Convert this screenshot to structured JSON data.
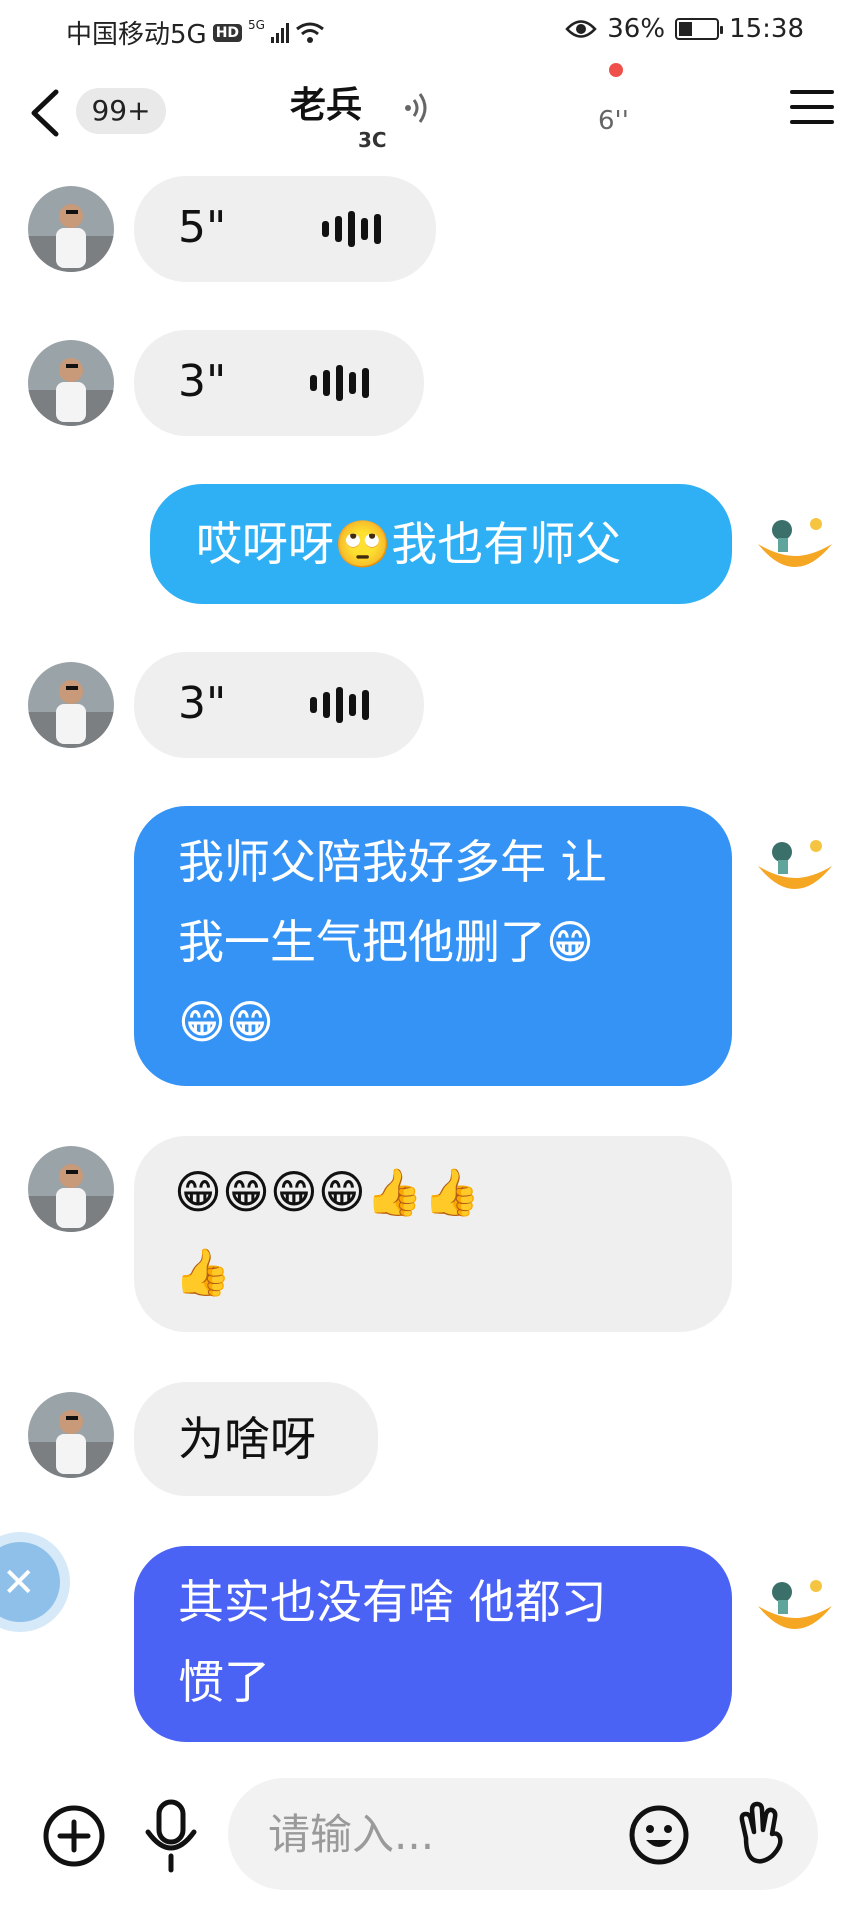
{
  "status_bar": {
    "carrier": "中国移动5G",
    "hd_badge": "HD",
    "net_label": "5G",
    "battery": "36%",
    "battery_level": 0.36,
    "time": "15:38"
  },
  "header": {
    "unread_badge": "99+",
    "title": "老兵",
    "subtitle": "3C",
    "recording_time": "6''"
  },
  "messages": [
    {
      "side": "received",
      "type": "voice",
      "duration": "5\""
    },
    {
      "side": "received",
      "type": "voice",
      "duration": "3\""
    },
    {
      "side": "sent",
      "type": "text",
      "text": "哎呀呀🙄我也有师父"
    },
    {
      "side": "received",
      "type": "voice",
      "duration": "3\""
    },
    {
      "side": "sent",
      "type": "text",
      "line1": "我师父陪我好多年 让",
      "line2": "我一生气把他删了😁",
      "line3": "😁😁"
    },
    {
      "side": "received",
      "type": "text",
      "line1": "😁😁😁😁👍👍",
      "line2": "👍"
    },
    {
      "side": "received",
      "type": "text",
      "text": "为啥呀"
    },
    {
      "side": "sent",
      "type": "text",
      "line1": "其实也没有啥 他都习",
      "line2": "惯了"
    }
  ],
  "colors": {
    "sent_bubble_1": "#2fb0f5",
    "sent_bubble_2": "#3593f5",
    "sent_bubble_3": "#4b63f5",
    "received_bubble": "#efefef"
  },
  "input": {
    "placeholder": "请输入..."
  },
  "icons": {
    "back": "chevron-left-icon",
    "menu": "hamburger-icon",
    "add": "plus-circle-icon",
    "voice": "microphone-icon",
    "emoji": "smile-icon",
    "gesture": "hand-icon",
    "side": "close-icon"
  }
}
